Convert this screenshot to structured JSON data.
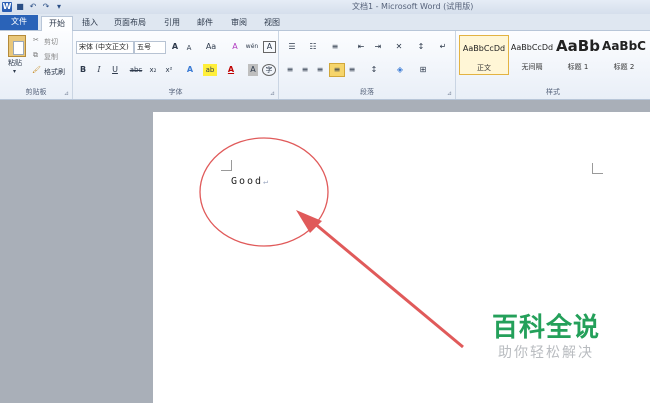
{
  "title_bar": {
    "window_title": "文档1 - Microsoft Word (试用版)"
  },
  "quick_access": {
    "undo": "↶",
    "redo": "↷"
  },
  "tabs": [
    {
      "label": "文件"
    },
    {
      "label": "开始"
    },
    {
      "label": "插入"
    },
    {
      "label": "页面布局"
    },
    {
      "label": "引用"
    },
    {
      "label": "邮件"
    },
    {
      "label": "审阅"
    },
    {
      "label": "视图"
    }
  ],
  "clipboard": {
    "paste": "粘贴",
    "cut": "剪切",
    "copy": "复制",
    "format_painter": "格式刷",
    "group_label": "剪贴板"
  },
  "font": {
    "font_name": "宋体 (中文正文)",
    "font_size": "五号",
    "grow": "A",
    "shrink": "A",
    "change_case": "Aa",
    "clear_format": "A",
    "phonetic": "wén",
    "char_border": "A",
    "bold": "B",
    "italic": "I",
    "underline": "U",
    "strike": "abc",
    "subscript": "x₂",
    "superscript": "x²",
    "highlight": "ab",
    "font_color": "A",
    "char_shading": "A",
    "enclose": "字",
    "group_label": "字体"
  },
  "paragraph": {
    "group_label": "段落"
  },
  "styles": {
    "items": [
      {
        "sample": "AaBbCcDd",
        "name": "正文"
      },
      {
        "sample": "AaBbCcDd",
        "name": "无间隔"
      },
      {
        "sample": "AaBb",
        "name": "标题 1"
      },
      {
        "sample": "AaBbC",
        "name": "标题 2"
      }
    ],
    "group_label": "样式"
  },
  "document": {
    "text": "Good",
    "paragraph_mark": "↵"
  },
  "annotation": {
    "ellipse_color": "#e05a5a",
    "arrow_color": "#e05a5a"
  },
  "watermark": {
    "title": "百科全说",
    "subtitle": "助你轻松解决"
  }
}
